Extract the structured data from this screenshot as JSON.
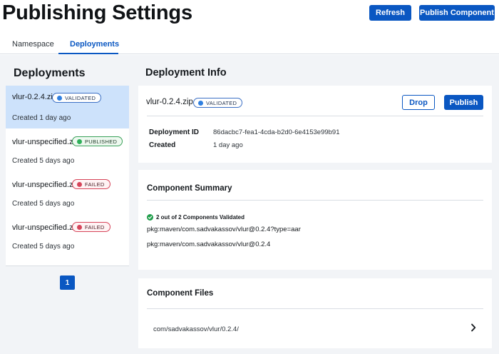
{
  "header": {
    "title": "Publishing Settings",
    "refresh_label": "Refresh",
    "publish_component_label": "Publish Component"
  },
  "tabs": [
    {
      "label": "Namespace",
      "active": false
    },
    {
      "label": "Deployments",
      "active": true
    }
  ],
  "sidebar": {
    "title": "Deployments",
    "items": [
      {
        "name": "vlur-0.2.4.zip",
        "status": "VALIDATED",
        "created": "Created 1 day ago",
        "selected": true
      },
      {
        "name": "vlur-unspecified.zip",
        "status": "PUBLISHED",
        "created": "Created 5 days ago",
        "selected": false
      },
      {
        "name": "vlur-unspecified.zip",
        "status": "FAILED",
        "created": "Created 5 days ago",
        "selected": false
      },
      {
        "name": "vlur-unspecified.zip",
        "status": "FAILED",
        "created": "Created 5 days ago",
        "selected": false
      }
    ],
    "pagination": {
      "current_page": "1"
    }
  },
  "deployment_info": {
    "title": "Deployment Info",
    "name": "vlur-0.2.4.zip",
    "status": "VALIDATED",
    "drop_label": "Drop",
    "publish_label": "Publish",
    "fields": [
      {
        "label": "Deployment ID",
        "value": "86dacbc7-fea1-4cda-b2d0-6e4153e99b91"
      },
      {
        "label": "Created",
        "value": "1 day ago"
      }
    ]
  },
  "component_summary": {
    "title": "Component Summary",
    "validation_summary": "2 out of 2 Components Validated",
    "components": [
      "pkg:maven/com.sadvakassov/vlur@0.2.4?type=aar",
      "pkg:maven/com.sadvakassov/vlur@0.2.4"
    ]
  },
  "component_files": {
    "title": "Component Files",
    "files": [
      "com/sadvakassov/vlur/0.2.4/"
    ]
  },
  "colors": {
    "primary": "#0a57c2",
    "selected_bg": "#cde2fb",
    "validated": "#2f7fe0",
    "published": "#2fb05a",
    "failed": "#d6455a",
    "background": "#f2f4f7"
  }
}
